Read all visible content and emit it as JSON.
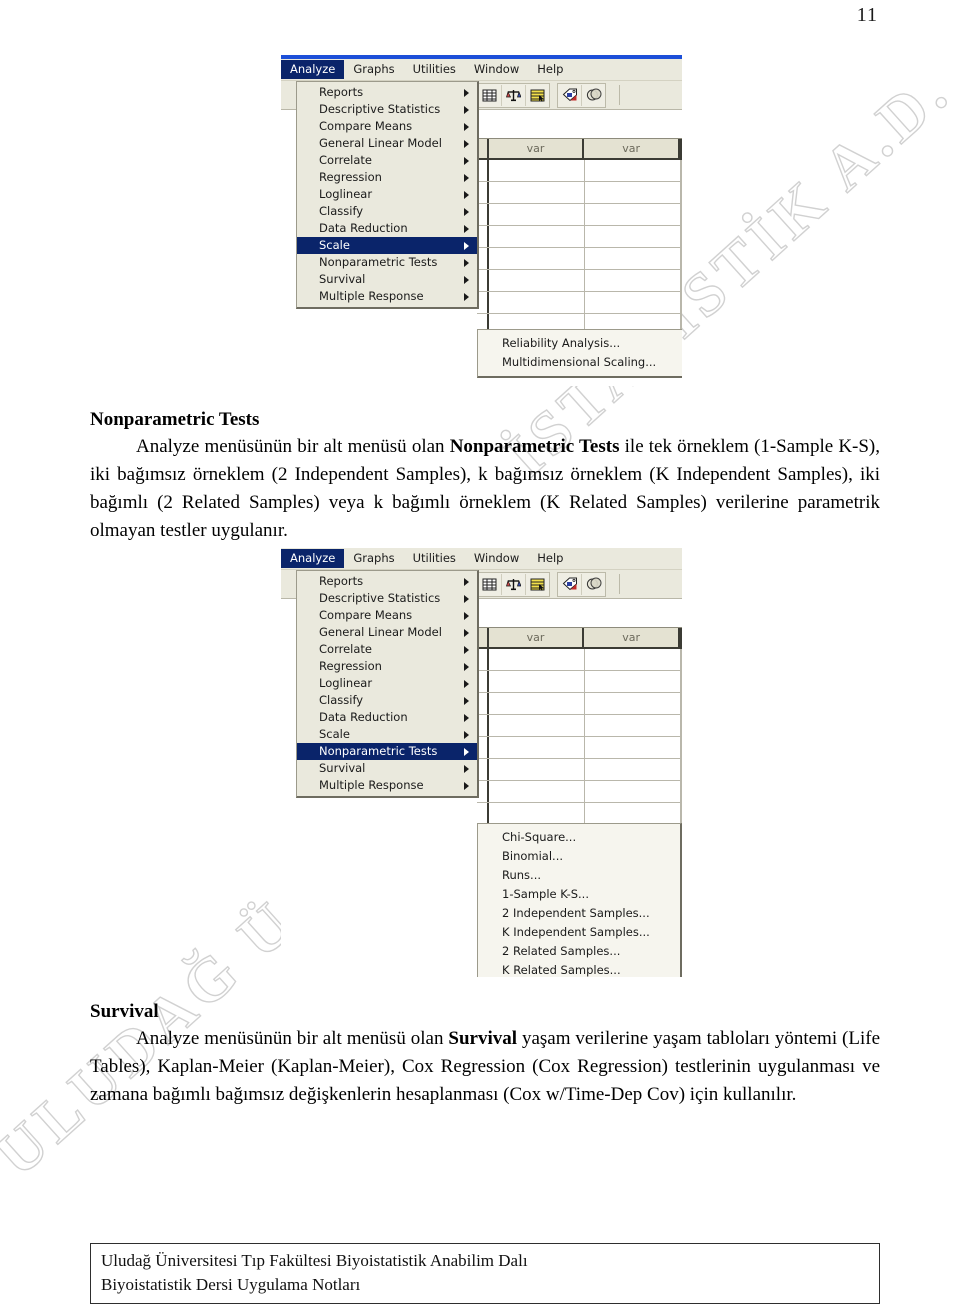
{
  "page": {
    "number": "11"
  },
  "watermarks": {
    "top": "İSTATİSTİK A.D.",
    "bottom": "ULUDAĞ Ü"
  },
  "screenshot_one": {
    "menubar": [
      {
        "label": "Analyze",
        "active": true
      },
      {
        "label": "Graphs",
        "active": false
      },
      {
        "label": "Utilities",
        "active": false
      },
      {
        "label": "Window",
        "active": false
      },
      {
        "label": "Help",
        "active": false
      }
    ],
    "toolbar_icons": [
      "open-file-icon",
      "weighted-cases-icon",
      "select-cases-icon",
      "value-labels-icon",
      "use-sets-icon"
    ],
    "grid": {
      "column_headers": [
        "",
        "var",
        "var",
        ""
      ],
      "row_count": 9
    },
    "analyze_menu": [
      {
        "label": "Reports",
        "has_submenu": true,
        "selected": false
      },
      {
        "label": "Descriptive Statistics",
        "has_submenu": true,
        "selected": false
      },
      {
        "label": "Compare Means",
        "has_submenu": true,
        "selected": false
      },
      {
        "label": "General Linear Model",
        "has_submenu": true,
        "selected": false
      },
      {
        "label": "Correlate",
        "has_submenu": true,
        "selected": false
      },
      {
        "label": "Regression",
        "has_submenu": true,
        "selected": false
      },
      {
        "label": "Loglinear",
        "has_submenu": true,
        "selected": false
      },
      {
        "label": "Classify",
        "has_submenu": true,
        "selected": false
      },
      {
        "label": "Data Reduction",
        "has_submenu": true,
        "selected": false
      },
      {
        "label": "Scale",
        "has_submenu": true,
        "selected": true
      },
      {
        "label": "Nonparametric Tests",
        "has_submenu": true,
        "selected": false
      },
      {
        "label": "Survival",
        "has_submenu": true,
        "selected": false
      },
      {
        "label": "Multiple Response",
        "has_submenu": true,
        "selected": false
      }
    ],
    "submenu": {
      "parent": "Scale",
      "items": [
        "Reliability Analysis...",
        "Multidimensional Scaling..."
      ]
    }
  },
  "screenshot_two": {
    "menubar": [
      {
        "label": "Analyze",
        "active": true
      },
      {
        "label": "Graphs",
        "active": false
      },
      {
        "label": "Utilities",
        "active": false
      },
      {
        "label": "Window",
        "active": false
      },
      {
        "label": "Help",
        "active": false
      }
    ],
    "toolbar_icons": [
      "open-file-icon",
      "weighted-cases-icon",
      "select-cases-icon",
      "value-labels-icon",
      "use-sets-icon"
    ],
    "grid": {
      "column_headers": [
        "",
        "var",
        "var",
        ""
      ],
      "row_count": 13
    },
    "analyze_menu": [
      {
        "label": "Reports",
        "has_submenu": true,
        "selected": false
      },
      {
        "label": "Descriptive Statistics",
        "has_submenu": true,
        "selected": false
      },
      {
        "label": "Compare Means",
        "has_submenu": true,
        "selected": false
      },
      {
        "label": "General Linear Model",
        "has_submenu": true,
        "selected": false
      },
      {
        "label": "Correlate",
        "has_submenu": true,
        "selected": false
      },
      {
        "label": "Regression",
        "has_submenu": true,
        "selected": false
      },
      {
        "label": "Loglinear",
        "has_submenu": true,
        "selected": false
      },
      {
        "label": "Classify",
        "has_submenu": true,
        "selected": false
      },
      {
        "label": "Data Reduction",
        "has_submenu": true,
        "selected": false
      },
      {
        "label": "Scale",
        "has_submenu": true,
        "selected": false
      },
      {
        "label": "Nonparametric Tests",
        "has_submenu": true,
        "selected": true
      },
      {
        "label": "Survival",
        "has_submenu": true,
        "selected": false
      },
      {
        "label": "Multiple Response",
        "has_submenu": true,
        "selected": false
      }
    ],
    "submenu": {
      "parent": "Nonparametric Tests",
      "items": [
        "Chi-Square...",
        "Binomial...",
        "Runs...",
        "1-Sample K-S...",
        "2 Independent Samples...",
        "K Independent Samples...",
        "2 Related Samples...",
        "K Related Samples..."
      ]
    }
  },
  "sections": {
    "nonparametric": {
      "title": "Nonparametric Tests",
      "paragraph_parts": [
        {
          "text": "Analyze menüsünün bir alt menüsü olan ",
          "bold": false
        },
        {
          "text": "Nonparametric Tests",
          "bold": true
        },
        {
          "text": " ile tek örneklem (1-Sample K-S), iki bağımsız örneklem (2 Independent Samples), k bağımsız örneklem (K Independent Samples), iki bağımlı (2 Related Samples) veya k bağımlı örneklem (K Related Samples) verilerine parametrik olmayan testler uygulanır.",
          "bold": false
        }
      ]
    },
    "survival": {
      "title": "Survival",
      "paragraph_parts": [
        {
          "text": "Analyze menüsünün bir alt menüsü olan ",
          "bold": false
        },
        {
          "text": "Survival",
          "bold": true
        },
        {
          "text": " yaşam verilerine yaşam tabloları yöntemi (Life Tables), Kaplan-Meier (Kaplan-Meier), Cox Regression (Cox Regression) testlerinin uygulanması ve zamana bağımlı bağımsız değişkenlerin hesaplanması (Cox w/Time-Dep Cov) için kullanılır.",
          "bold": false
        }
      ]
    }
  },
  "footer": {
    "line1": "Uludağ Üniversitesi Tıp Fakültesi Biyoistatistik Anabilim Dalı",
    "line2": "Biyoistatistik Dersi Uygulama Notları"
  },
  "colors": {
    "menu_highlight": "#0a246a",
    "title_strip": "#1c4fd8",
    "menu_face": "#eae9dd",
    "grid_header": "#e4e2d2"
  }
}
